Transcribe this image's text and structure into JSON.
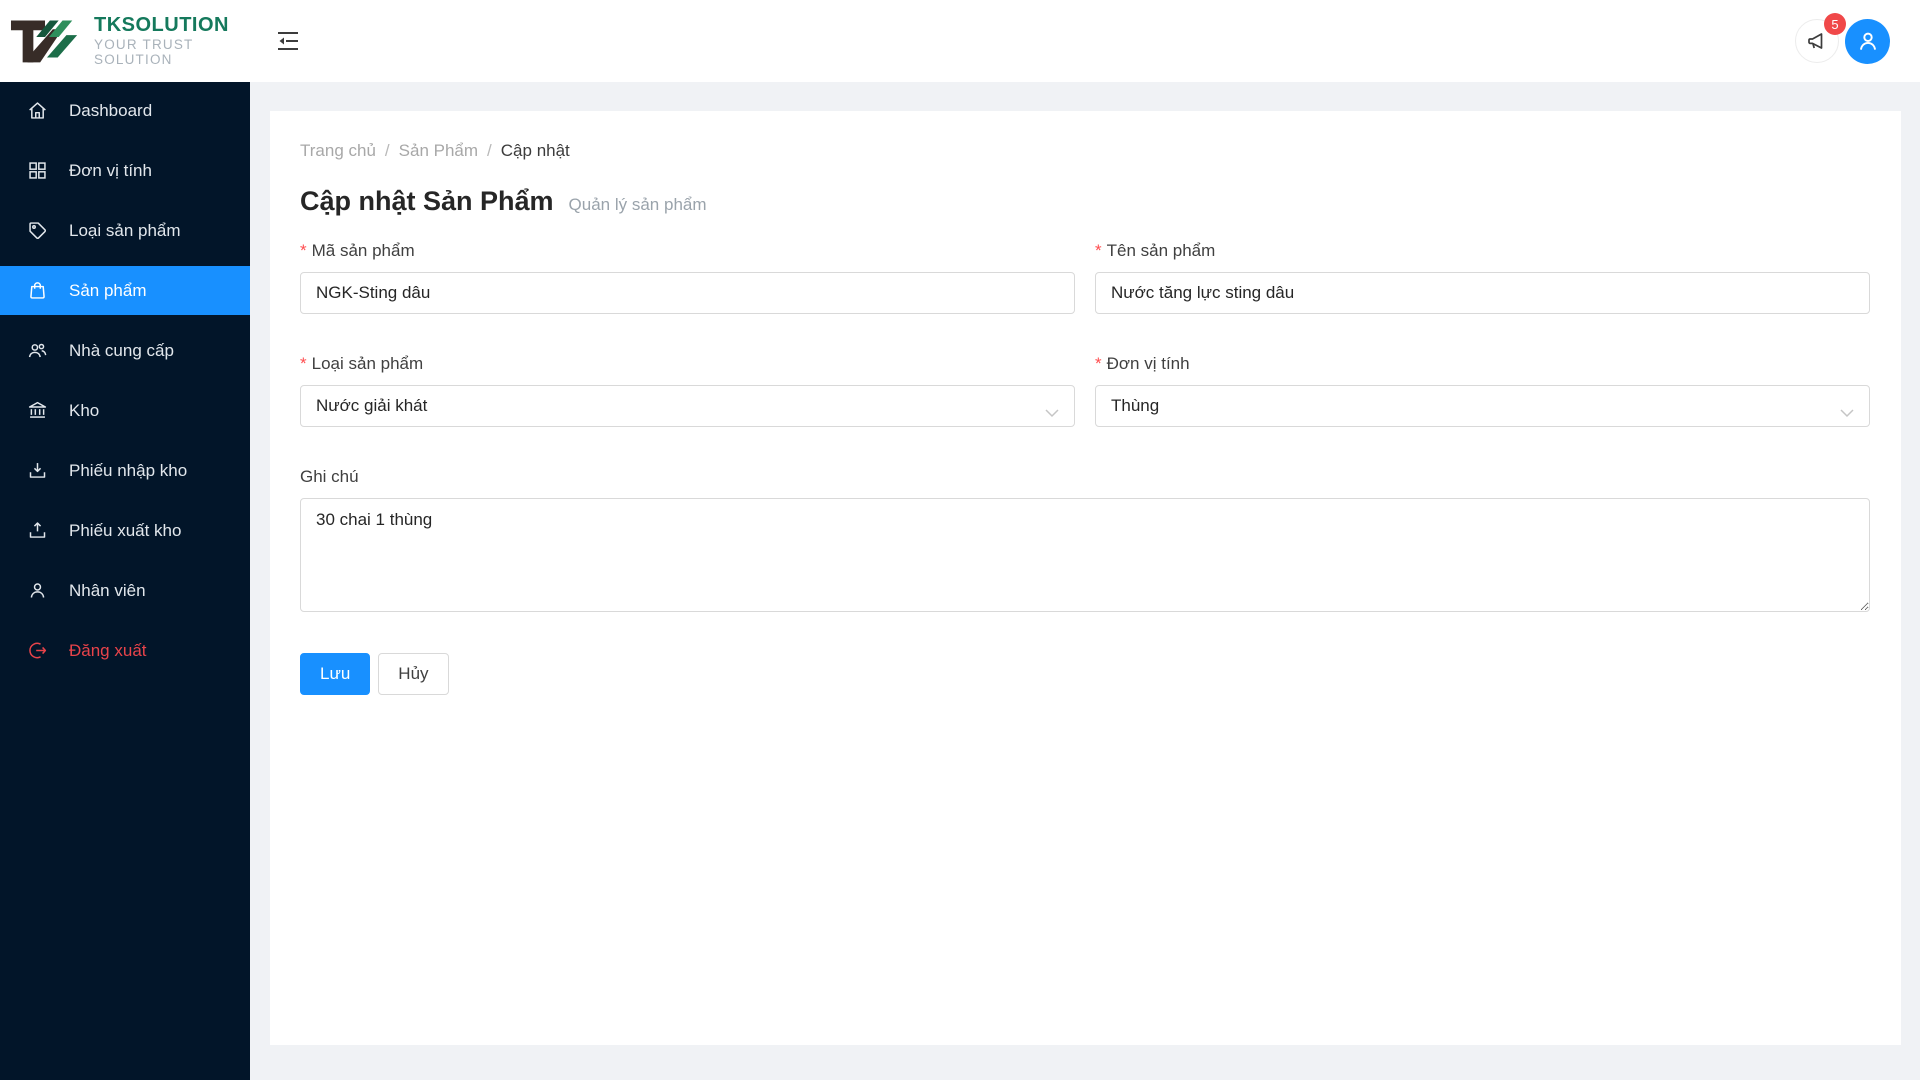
{
  "header": {
    "logo": {
      "brand": "TKSOLUTION",
      "tagline": "YOUR TRUST SOLUTION"
    },
    "notification_badge": "5"
  },
  "sidebar": {
    "items": [
      {
        "label": "Dashboard",
        "icon": "home-icon",
        "active": false
      },
      {
        "label": "Đơn vị tính",
        "icon": "appstore-icon",
        "active": false
      },
      {
        "label": "Loại sản phẩm",
        "icon": "tag-icon",
        "active": false
      },
      {
        "label": "Sản phẩm",
        "icon": "shopping-bag-icon",
        "active": true
      },
      {
        "label": "Nhà cung cấp",
        "icon": "team-icon",
        "active": false
      },
      {
        "label": "Kho",
        "icon": "bank-icon",
        "active": false
      },
      {
        "label": "Phiếu nhập kho",
        "icon": "import-icon",
        "active": false
      },
      {
        "label": "Phiếu xuất kho",
        "icon": "export-icon",
        "active": false
      },
      {
        "label": "Nhân viên",
        "icon": "user-icon",
        "active": false
      },
      {
        "label": "Đăng xuất",
        "icon": "logout-icon",
        "active": false,
        "danger": true
      }
    ]
  },
  "breadcrumb": {
    "items": [
      "Trang chủ",
      "Sản Phẩm",
      "Cập nhật"
    ],
    "separator": "/"
  },
  "page": {
    "title": "Cập nhật Sản Phẩm",
    "subtitle": "Quản lý sản phẩm"
  },
  "form": {
    "required_marker": "*",
    "fields": {
      "ma_san_pham": {
        "label": "Mã sản phẩm",
        "value": "NGK-Sting dâu"
      },
      "ten_san_pham": {
        "label": "Tên sản phẩm",
        "value": "Nước tăng lực sting dâu"
      },
      "loai_san_pham": {
        "label": "Loại sản phẩm",
        "value": "Nước giải khát"
      },
      "don_vi_tinh": {
        "label": "Đơn vị tính",
        "value": "Thùng"
      },
      "ghi_chu": {
        "label": "Ghi chú",
        "value": "30 chai 1 thùng"
      }
    },
    "buttons": {
      "save": "Lưu",
      "cancel": "Hủy"
    }
  },
  "colors": {
    "accent": "#1890ff",
    "sidebar_bg": "#021529",
    "danger": "#e8434a",
    "badge": "#f04849",
    "brand_green": "#15795c",
    "page_bg": "#f0f2f5"
  }
}
